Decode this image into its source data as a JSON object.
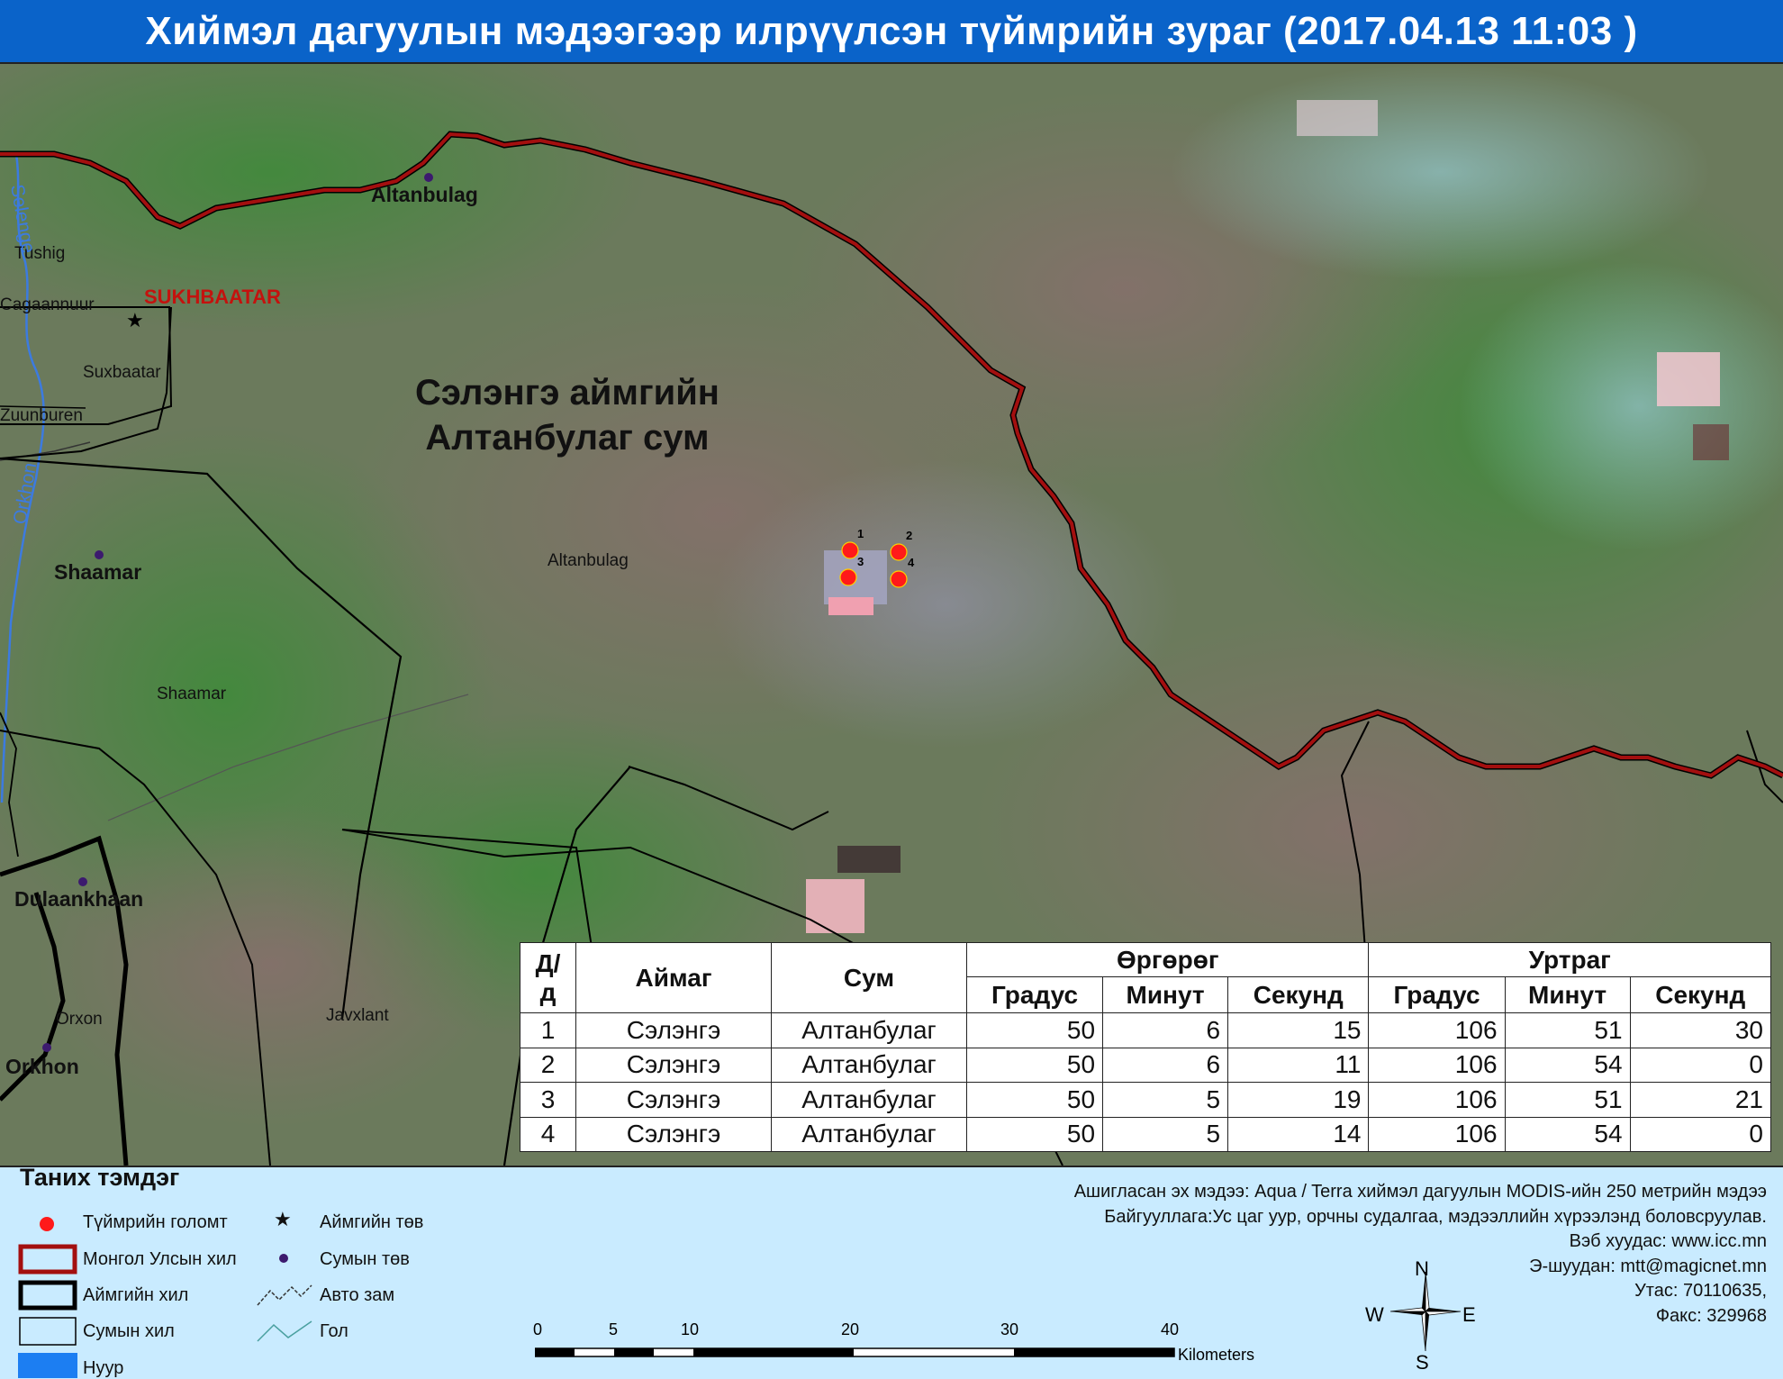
{
  "title": "Хиймэл дагуулын мэдээгээр илрүүлсэн түймрийн зураг  (2017.04.13  11:03 )",
  "colors": {
    "title_bar": "#0a63c9",
    "border_national": "#a30f0f",
    "fire_point": "#ff1a1a",
    "legend_bg": "#c9ebff",
    "lake": "#1c7ef2"
  },
  "map": {
    "region_label_line1": "Сэлэнгэ аймгийн",
    "region_label_line2": "Алтанбулаг сум",
    "places": {
      "altanbulag_center": "Altanbulag",
      "tushig": "Tushig",
      "sukhbaatar": "SUKHBAATAR",
      "cagaannuur": "Cagaannuur",
      "suxbaatar": "Suxbaatar",
      "zuunburen": "Zuunburen",
      "shaamar_center": "Shaamar",
      "altanbulag_sum": "Altanbulag",
      "shaamar_sum": "Shaamar",
      "dulaankhaan": "Dulaankhaan",
      "orxon": "Orxon",
      "javxlant": "Javxlant",
      "orkhon_center": "Orkhon"
    },
    "rivers": {
      "selenge": "Selenge",
      "orkhon": "Orkhon"
    },
    "fire_labels": [
      "1",
      "2",
      "3",
      "4"
    ]
  },
  "table": {
    "headers": {
      "no": "Д/д",
      "aimag": "Аймаг",
      "sum": "Сум",
      "latitude": "Өргөрөг",
      "longitude": "Уртраг",
      "deg": "Градус",
      "min": "Минут",
      "sec": "Секунд"
    },
    "rows": [
      {
        "no": "1",
        "aimag": "Сэлэнгэ",
        "sum": "Алтанбулаг",
        "lat_deg": "50",
        "lat_min": "6",
        "lat_sec": "15",
        "lon_deg": "106",
        "lon_min": "51",
        "lon_sec": "30"
      },
      {
        "no": "2",
        "aimag": "Сэлэнгэ",
        "sum": "Алтанбулаг",
        "lat_deg": "50",
        "lat_min": "6",
        "lat_sec": "11",
        "lon_deg": "106",
        "lon_min": "54",
        "lon_sec": "0"
      },
      {
        "no": "3",
        "aimag": "Сэлэнгэ",
        "sum": "Алтанбулаг",
        "lat_deg": "50",
        "lat_min": "5",
        "lat_sec": "19",
        "lon_deg": "106",
        "lon_min": "51",
        "lon_sec": "21"
      },
      {
        "no": "4",
        "aimag": "Сэлэнгэ",
        "sum": "Алтанбулаг",
        "lat_deg": "50",
        "lat_min": "5",
        "lat_sec": "14",
        "lon_deg": "106",
        "lon_min": "54",
        "lon_sec": "0"
      }
    ]
  },
  "legend": {
    "title": "Таних тэмдэг",
    "fire": "Түймрийн голомт",
    "national_border": "Монгол Улсын хил",
    "aimag_border": "Аймгийн хил",
    "sum_border": "Сумын хил",
    "lake": "Нуур",
    "aimag_center": "Аймгийн төв",
    "sum_center": "Сумын төв",
    "road": "Авто зам",
    "river": "Гол"
  },
  "info": {
    "line1": "Ашигласан эх мэдээ: Aqua / Terra хиймэл дагуулын MODIS-ийн 250 метрийн мэдээ",
    "line2": "Байгууллага:Ус цаг уур, орчны судалгаа, мэдээллийн хүрээлэнд боловсруулав.",
    "line3": "Вэб хуудас: www.icc.mn",
    "line4": "Э-шуудан: mtt@magicnet.mn",
    "line5": "Утас: 70110635,",
    "line6": "Факс: 329968"
  },
  "compass": {
    "n": "N",
    "s": "S",
    "e": "E",
    "w": "W"
  },
  "scale": {
    "ticks": [
      "0",
      "5",
      "10",
      "20",
      "30",
      "40"
    ],
    "unit": "Kilometers"
  }
}
